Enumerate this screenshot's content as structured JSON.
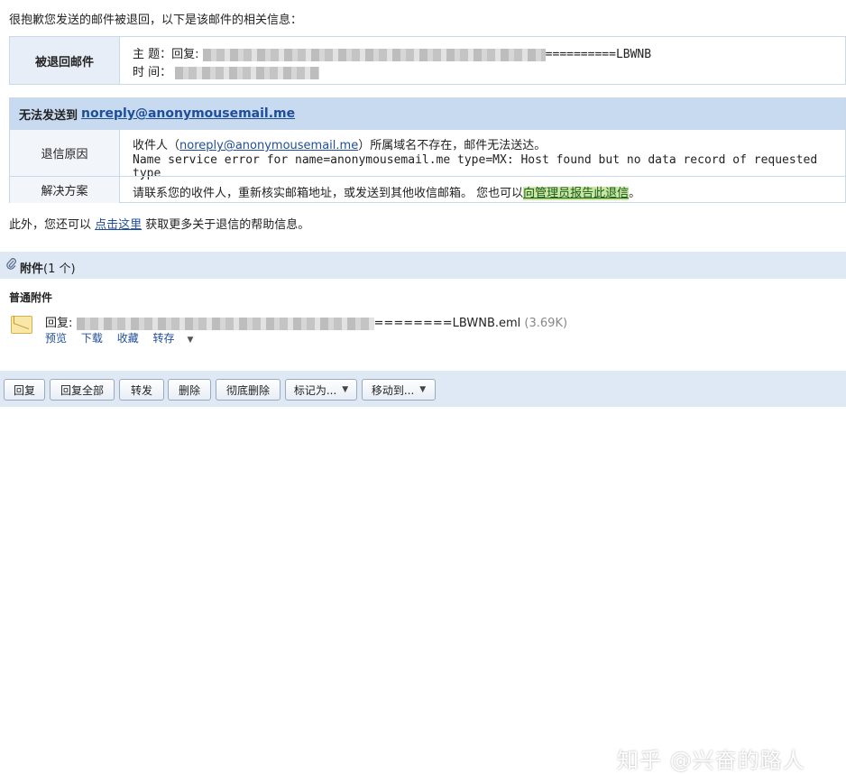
{
  "intro": "很抱歉您发送的邮件被退回，以下是该邮件的相关信息：",
  "bounced": {
    "label": "被退回邮件",
    "subject_label": "主 题：",
    "subject_prefix": "回复:",
    "subject_suffix": "==========LBWNB",
    "time_label": "时 间："
  },
  "failure": {
    "title": "无法发送到",
    "address": "noreply@anonymousemail.me",
    "reason_label": "退信原因",
    "reason_line1_prefix": "收件人（",
    "reason_line1_link": "noreply@anonymousemail.me",
    "reason_line1_suffix": "）所属域名不存在，邮件无法送达。",
    "reason_line2": "Name service error for name=anonymousemail.me type=MX: Host found but no data record of requested type",
    "solution_label": "解决方案",
    "solution_text": "请联系您的收件人，重新核实邮箱地址，或发送到其他收信邮箱。 您也可以",
    "solution_link": "向管理员报告此退信",
    "solution_end": "。"
  },
  "extra": {
    "prefix": "此外，您还可以 ",
    "link": "点击这里",
    "suffix": " 获取更多关于退信的帮助信息。"
  },
  "attachments": {
    "title": "附件",
    "count": "(1 个)",
    "subhead": "普通附件",
    "file_prefix": "回复:",
    "file_suffix": "========LBWNB.eml",
    "file_size": "(3.69K)",
    "actions": [
      "预览",
      "下载",
      "收藏",
      "转存"
    ]
  },
  "toolbar": {
    "buttons": [
      "回复",
      "回复全部",
      "转发",
      "删除",
      "彻底删除",
      "标记为...",
      "移动到..."
    ]
  },
  "watermark": "知乎 @兴奋的路人",
  "icons": {
    "attachment": "paperclip-icon",
    "file": "email-file-icon",
    "dropdown": "chevron-down-icon"
  }
}
